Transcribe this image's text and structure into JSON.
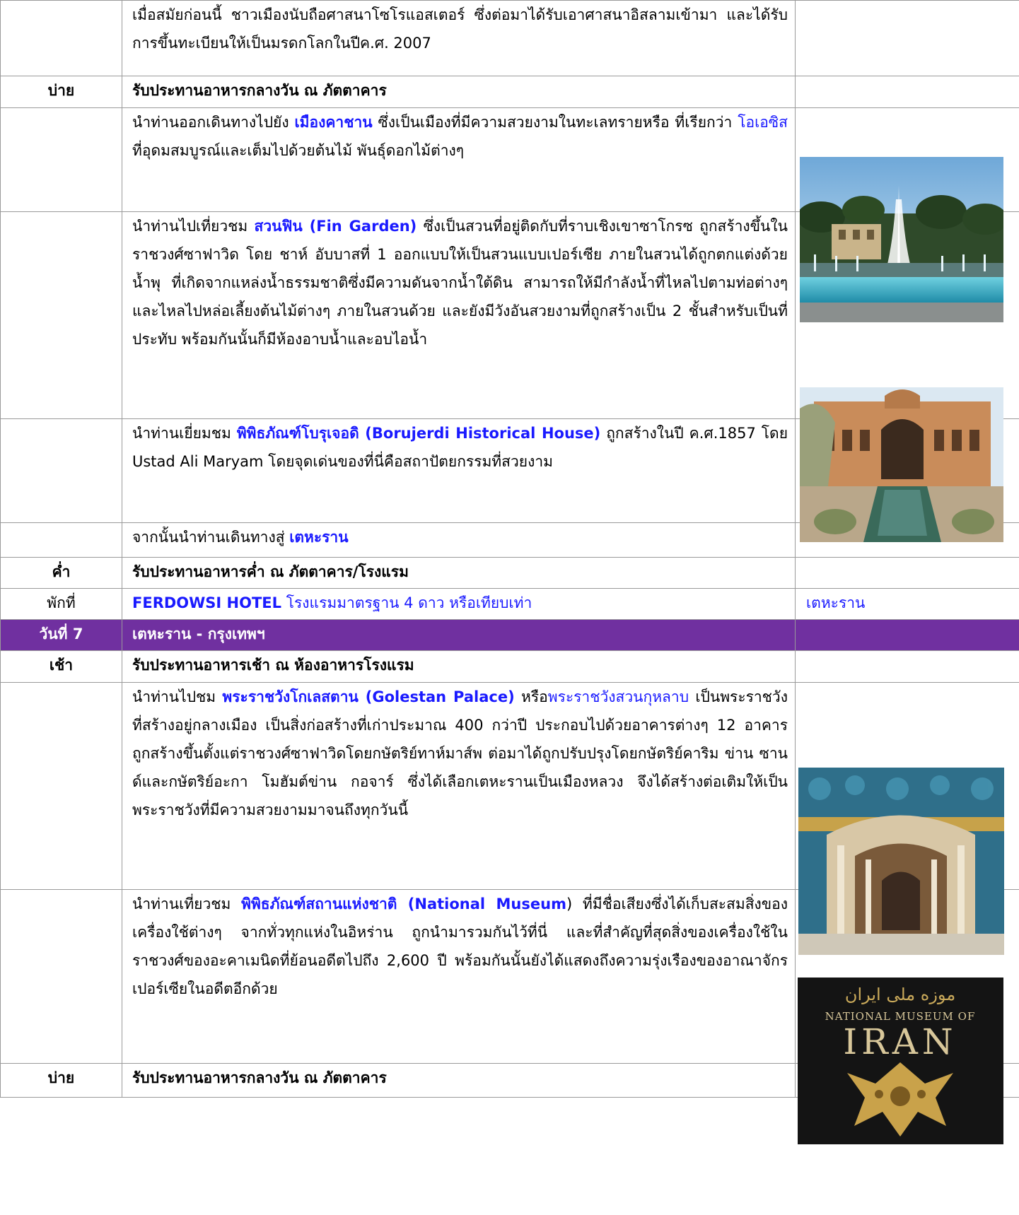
{
  "rows": {
    "r0": {
      "text": "เมื่อสมัยก่อนนี้ ชาวเมืองนับถือศาสนาโซโรแอสเตอร์ ซึ่งต่อมาได้รับเอาศาสนาอิสลามเข้ามา และได้รับการขึ้นทะเบียนให้เป็นมรดกโลกในปีค.ศ. 2007"
    },
    "r1": {
      "time": "บ่าย",
      "text": "รับประทานอาหารกลางวัน ณ ภัตตาคาร"
    },
    "r2": {
      "a": "นำท่านออกเดินทางไปยัง ",
      "b": "เมืองคาชาน",
      "c": " ซึ่งเป็นเมืองที่มีความสวยงามในทะเลทรายหรือ ที่เรียกว่า ",
      "d": "โอเอซิส",
      "e": " ที่อุดมสมบูรณ์และเต็มไปด้วยต้นไม้ พันธุ์ดอกไม้ต่างๆ"
    },
    "r3": {
      "a": "นำท่านไปเที่ยวชม ",
      "b": "สวนฟิน (Fin Garden)",
      "c": " ซึ่งเป็นสวนที่อยู่ติดกับที่ราบเชิงเขาซาโกรซ ถูกสร้างขึ้นในราชวงศ์ซาฟาวิด โดย ชาห์ อับบาสที่ 1 ออกแบบให้เป็นสวนแบบเปอร์เซีย ภายในสวนได้ถูกตกแต่งด้วยน้ำพุ ที่เกิดจากแหล่งน้ำธรรมชาติซึ่งมีความดันจากน้ำใต้ดิน สามารถให้มีกำลังน้ำที่ไหลไปตามท่อต่างๆ และไหลไปหล่อเลี้ยงต้นไม้ต่างๆ ภายในสวนด้วย และยังมีวังอันสวยงามที่ถูกสร้างเป็น 2 ชั้นสำหรับเป็นที่ประทับ พร้อมกันนั้นก็มีห้องอาบน้ำและอบไอน้ำ"
    },
    "r4": {
      "a": "นำท่านเยี่ยมชม ",
      "b": "พิพิธภัณฑ์โบรุเจอดิ (Borujerdi Historical House)",
      "c": " ถูกสร้างในปี ค.ศ.1857 โดย Ustad Ali Maryam โดยจุดเด่นของที่นี่คือสถาปัตยกรรมที่สวยงาม"
    },
    "r5": {
      "a": "จากนั้นนำท่านเดินทางสู่ ",
      "b": "เตหะราน"
    },
    "r6": {
      "time": "ค่ำ",
      "text": "รับประทานอาหารค่ำ ณ ภัตตาคาร/โรงแรม"
    },
    "r7": {
      "time": "พักที่",
      "hotel": "FERDOWSI HOTEL",
      "desc": "  โรงแรมมาตรฐาน 4 ดาว หรือเทียบเท่า",
      "city": "เตหะราน"
    },
    "r8": {
      "day": "วันที่ 7",
      "title": "เตหะราน - กรุงเทพฯ"
    },
    "r9": {
      "time": "เช้า",
      "text": "รับประทานอาหารเช้า ณ ห้องอาหารโรงแรม"
    },
    "r10": {
      "a": "นำท่านไปชม ",
      "b": "พระราชวังโกเลสตาน (Golestan Palace)",
      "c": " หรือ",
      "d": "พระราชวังสวนกุหลาบ",
      "e": " เป็นพระราชวังที่สร้างอยู่กลางเมือง เป็นสิ่งก่อสร้างที่เก่าประมาณ 400 กว่าปี ประกอบไปด้วยอาคารต่างๆ 12 อาคาร ถูกสร้างขึ้นตั้งแต่ราชวงศ์ซาฟาวิดโดยกษัตริย์ทาห์มาส์พ ต่อมาได้ถูกปรับปรุงโดยกษัตริย์คาริม ข่าน ซานด์และกษัตริย์อะกา โมฮัมต์ข่าน กอจาร์ ซึ่งได้เลือกเตหะรานเป็นเมืองหลวง จึงได้สร้างต่อเติมให้เป็นพระราชวังที่มีความสวยงามมาจนถึงทุกวันนี้"
    },
    "r11": {
      "a": "นำท่านเที่ยวชม ",
      "b": "พิพิธภัณฑ์สถานแห่งชาติ (National Museum",
      "c": ")  ที่มีชื่อเสียงซึ่งได้เก็บสะสมสิ่งของเครื่องใช้ต่างๆ จากทั่วทุกแห่งในอิหร่าน ถูกนำมารวมกันไว้ที่นี่ และที่สำคัญที่สุดสิ่งของเครื่องใช้ในราชวงศ์ของอะคาเมนิดที่ย้อนอดีตไปถึง 2,600 ปี พร้อมกันนั้นยังได้แสดงถึงความรุ่งเรืองของอาณาจักรเปอร์เซียในอดีตอีกด้วย"
    },
    "r12": {
      "time": "บ่าย",
      "text": "รับประทานอาหารกลางวัน ณ ภัตตาคาร"
    }
  },
  "museum_poster": {
    "persian": "موزه ملی ایران",
    "english": "NATIONAL MUSEUM OF",
    "country": "IRAN"
  },
  "colors": {
    "day_header": "#7030a0",
    "link_blue": "#1a1aff",
    "border": "#9a9a9a"
  }
}
